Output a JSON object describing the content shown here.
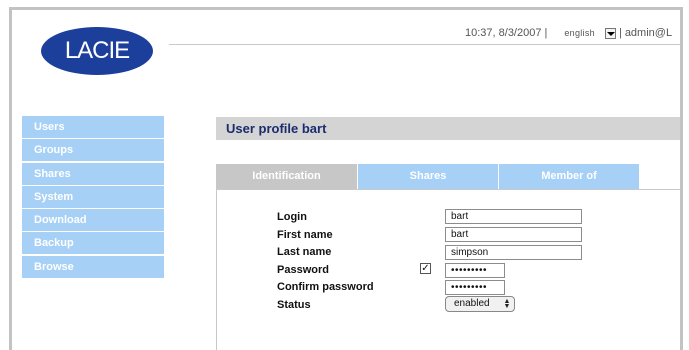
{
  "brand": {
    "logo_text": "LACIE"
  },
  "header": {
    "datetime": "10:37, 8/3/2007",
    "separator": "|",
    "language": "english",
    "admin_text": "admin@L"
  },
  "sidebar": {
    "items": [
      {
        "label": "Users"
      },
      {
        "label": "Groups"
      },
      {
        "label": "Shares"
      },
      {
        "label": "System"
      },
      {
        "label": "Download"
      },
      {
        "label": "Backup"
      },
      {
        "label": "Browse"
      }
    ]
  },
  "page": {
    "title": "User profile bart"
  },
  "tabs": [
    {
      "label": "Identification",
      "active": true
    },
    {
      "label": "Shares",
      "active": false
    },
    {
      "label": "Member of",
      "active": false
    }
  ],
  "form": {
    "labels": {
      "login": "Login",
      "first_name": "First name",
      "last_name": "Last name",
      "password": "Password",
      "confirm_password": "Confirm password",
      "status": "Status"
    },
    "values": {
      "login": "bart",
      "first_name": "bart",
      "last_name": "simpson",
      "password": "•••••••••",
      "confirm_password": "•••••••••",
      "status": "enabled",
      "password_checkbox": "✓"
    }
  },
  "colors": {
    "accent_blue": "#a6d0f5",
    "logo_blue": "#1d3f9c",
    "title_text": "#1b2c6d",
    "inactive_tab": "#c7c7c7"
  }
}
